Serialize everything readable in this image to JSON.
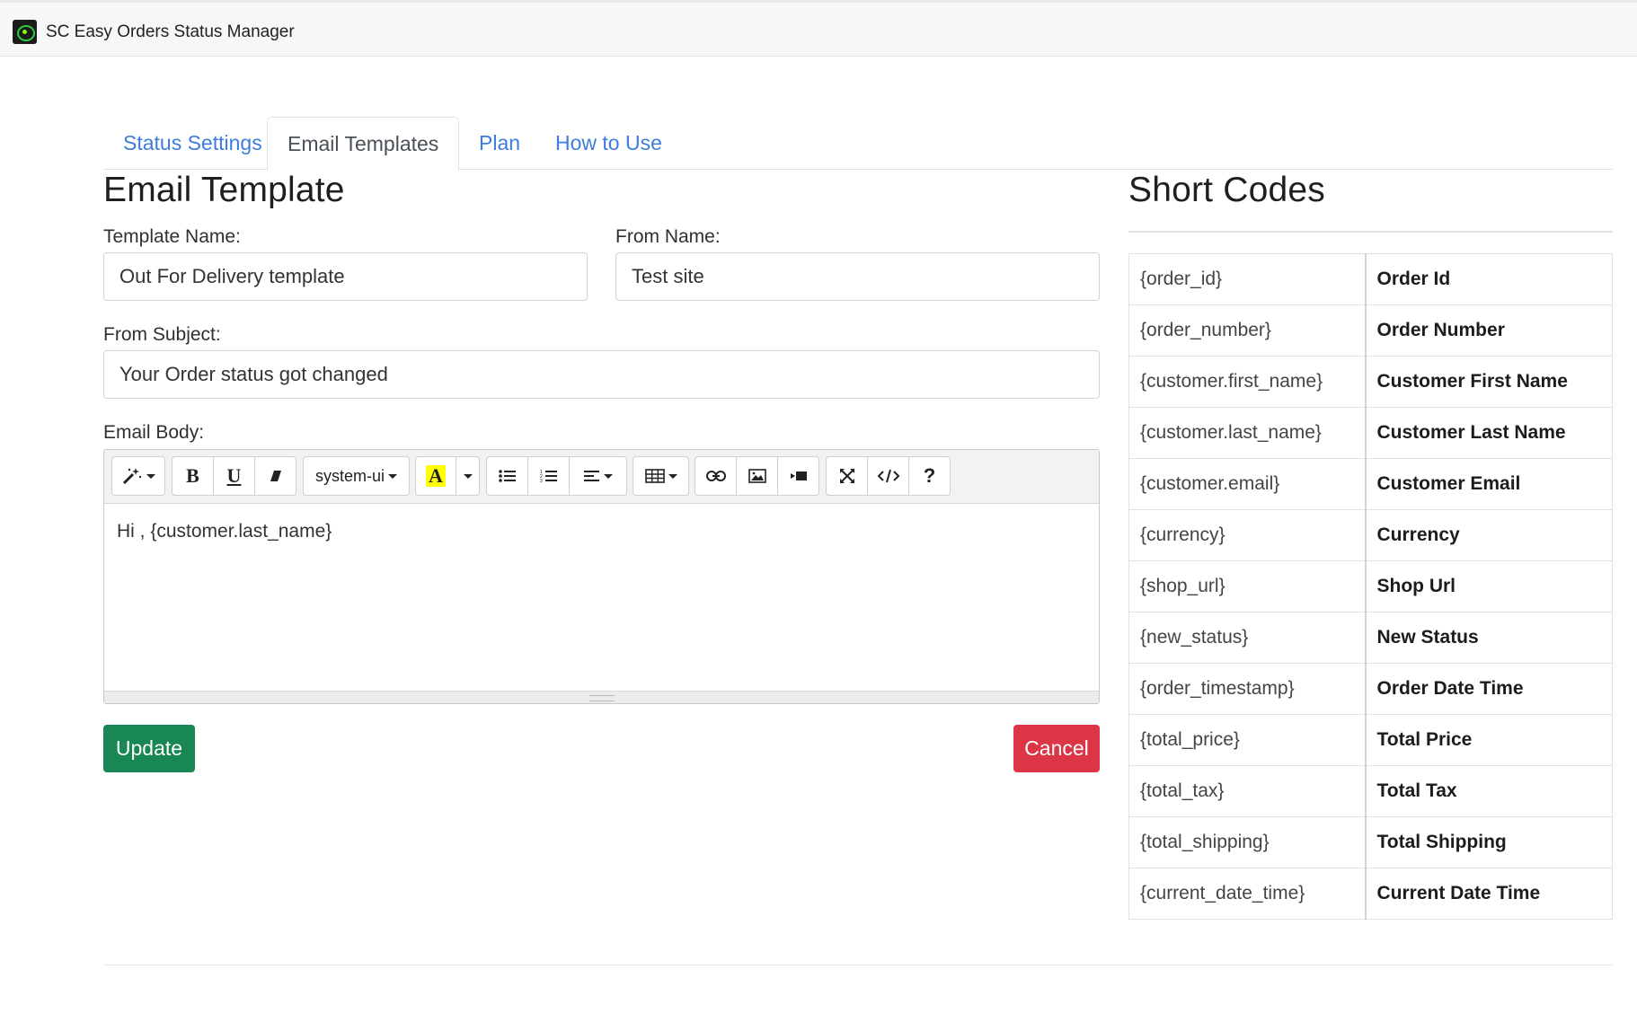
{
  "app": {
    "title": "SC Easy Orders Status Manager"
  },
  "tabs": [
    {
      "label": "Status Settings",
      "active": false
    },
    {
      "label": "Email Templates",
      "active": true
    },
    {
      "label": "Plan",
      "active": false
    },
    {
      "label": "How to Use",
      "active": false
    }
  ],
  "form": {
    "heading": "Email Template",
    "template_name": {
      "label": "Template Name:",
      "value": "Out For Delivery template"
    },
    "from_name": {
      "label": "From Name:",
      "value": "Test site"
    },
    "from_subject": {
      "label": "From Subject:",
      "value": "Your Order status got changed"
    },
    "email_body": {
      "label": "Email Body:",
      "content": "Hi , {customer.last_name}",
      "font_family_value": "system-ui"
    },
    "update_label": "Update",
    "cancel_label": "Cancel"
  },
  "short_codes": {
    "heading": "Short Codes",
    "rows": [
      {
        "code": "{order_id}",
        "desc": "Order Id"
      },
      {
        "code": "{order_number}",
        "desc": "Order Number"
      },
      {
        "code": "{customer.first_name}",
        "desc": "Customer First Name"
      },
      {
        "code": "{customer.last_name}",
        "desc": "Customer Last Name"
      },
      {
        "code": "{customer.email}",
        "desc": "Customer Email"
      },
      {
        "code": "{currency}",
        "desc": "Currency"
      },
      {
        "code": "{shop_url}",
        "desc": "Shop Url"
      },
      {
        "code": "{new_status}",
        "desc": "New Status"
      },
      {
        "code": "{order_timestamp}",
        "desc": "Order Date Time"
      },
      {
        "code": "{total_price}",
        "desc": "Total Price"
      },
      {
        "code": "{total_tax}",
        "desc": "Total Tax"
      },
      {
        "code": "{total_shipping}",
        "desc": "Total Shipping"
      },
      {
        "code": "{current_date_time}",
        "desc": "Current Date Time"
      }
    ]
  },
  "colors": {
    "link": "#3d7cdd",
    "update": "#198754",
    "cancel": "#dc3545",
    "highlight": "#ffff00"
  }
}
